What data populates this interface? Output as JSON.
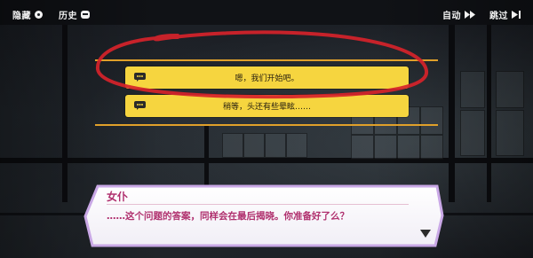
{
  "toolbar": {
    "hide_label": "隐藏",
    "history_label": "历史",
    "auto_label": "自动",
    "skip_label": "跳过"
  },
  "choices": [
    {
      "text": "嗯，我们开始吧。"
    },
    {
      "text": "稍等，头还有些晕眩……"
    }
  ],
  "dialog": {
    "speaker": "女仆",
    "text": "……这个问题的答案，同样会在最后揭晓。你准备好了么？"
  },
  "colors": {
    "choice_fill": "#f6d53f",
    "separator": "#e0a02a",
    "speaker_text": "#b0306e",
    "annotation_circle": "#d6232a"
  }
}
